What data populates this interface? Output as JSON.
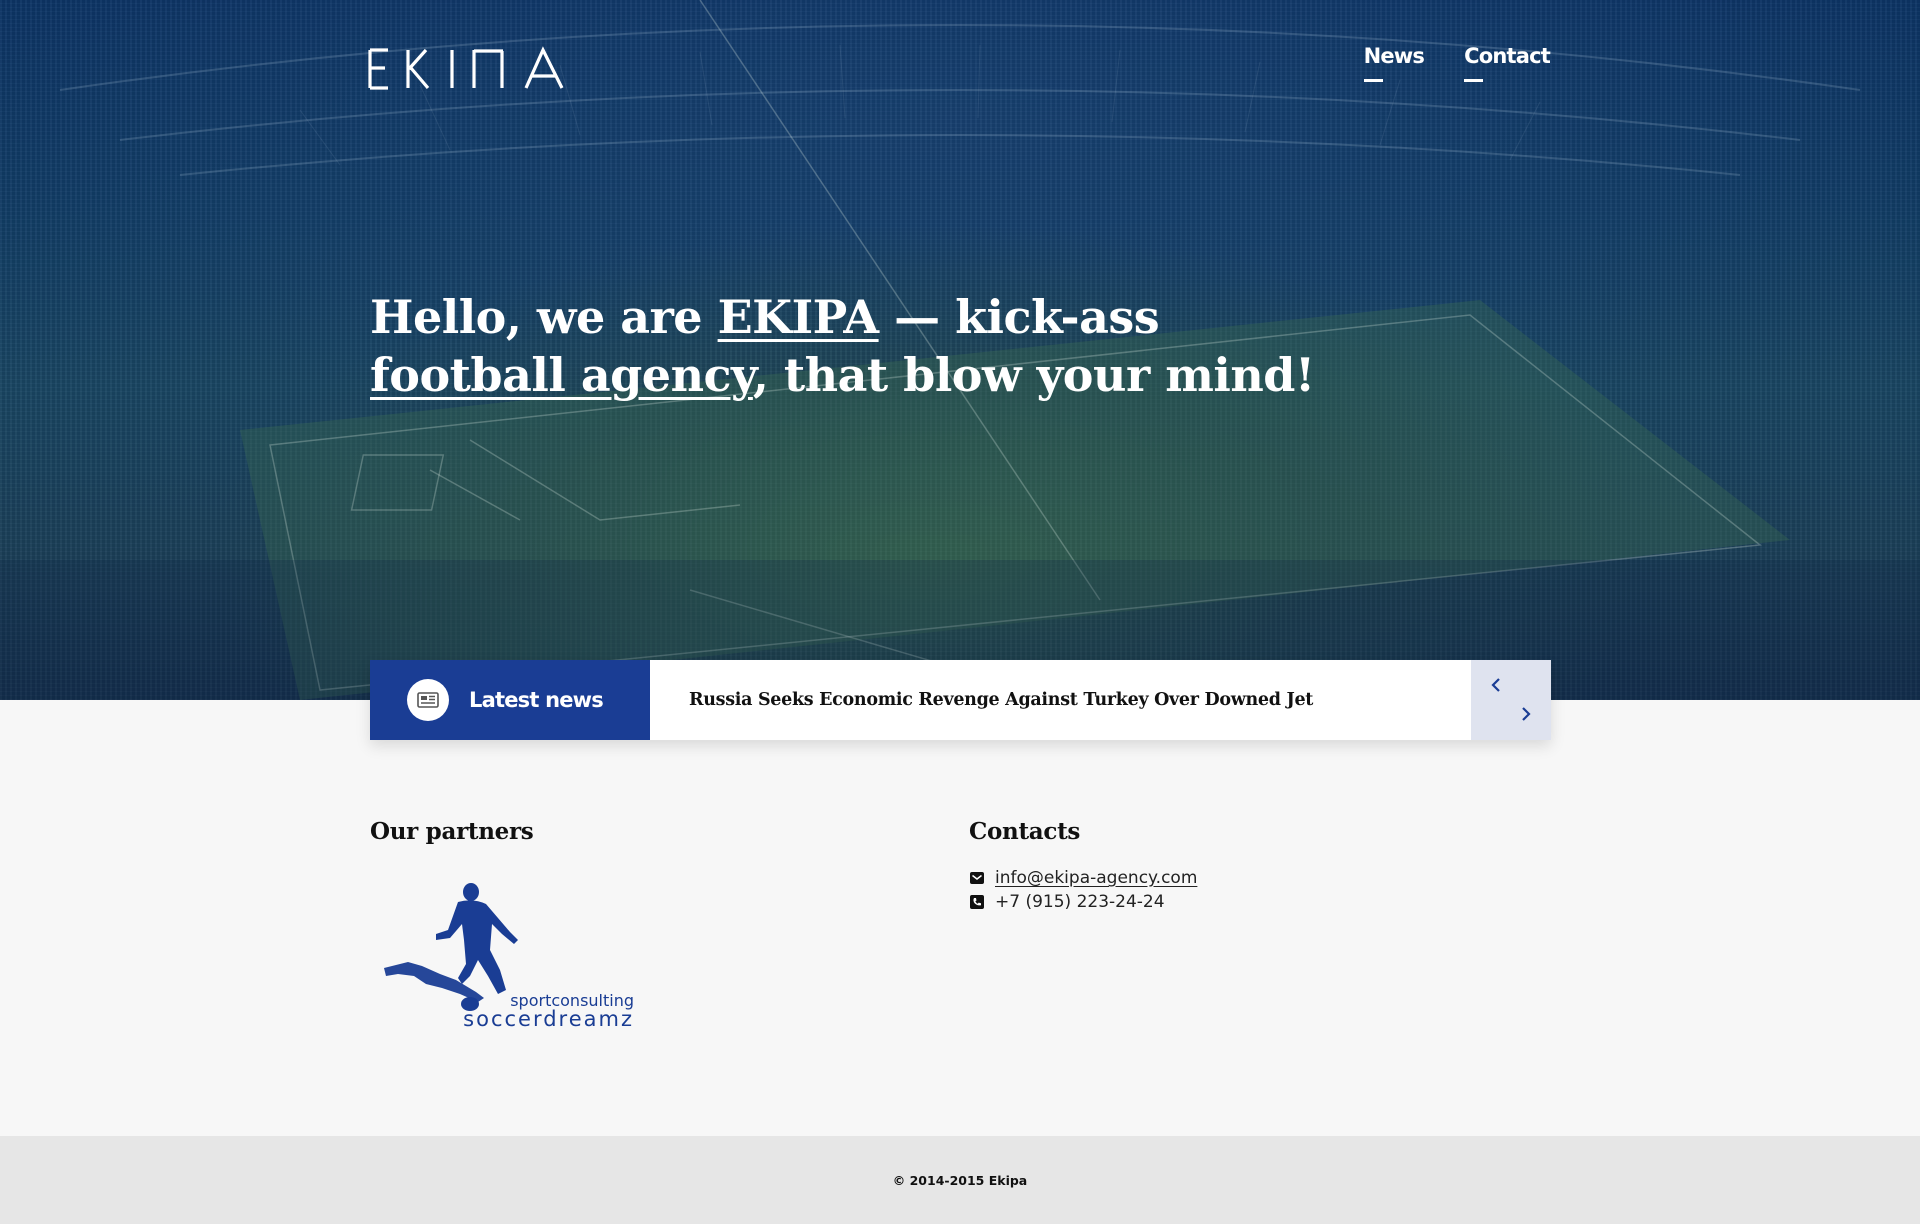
{
  "header": {
    "logo_text": "EKIΠA",
    "nav": [
      {
        "label": "News"
      },
      {
        "label": "Contact"
      }
    ]
  },
  "hero": {
    "line1_a": "Hello, we are ",
    "line1_link": "EKIPA",
    "line1_b": " — kick-ass",
    "line2_link": "football agency",
    "line2_b": ", that blow your mind!"
  },
  "news": {
    "label": "Latest news",
    "icon": "newspaper-icon",
    "headline": "Russia Seeks Economic Revenge Against Turkey Over Downed Jet",
    "prev_icon": "chevron-left-icon",
    "next_icon": "chevron-right-icon"
  },
  "partners": {
    "title": "Our partners",
    "logo_line1": "sportconsulting",
    "logo_line2": "soccerdreamz"
  },
  "contacts": {
    "title": "Contacts",
    "email": "info@ekipa-agency.com",
    "phone": "+7 (915) 223-24-24"
  },
  "footer": {
    "copyright": "© 2014-2015 Ekipa"
  },
  "colors": {
    "brand_blue": "#1a3d94",
    "hero_navy": "#0d3566",
    "arrows_bg": "#dfe3ef",
    "footer_bg": "#e6e6e6"
  }
}
